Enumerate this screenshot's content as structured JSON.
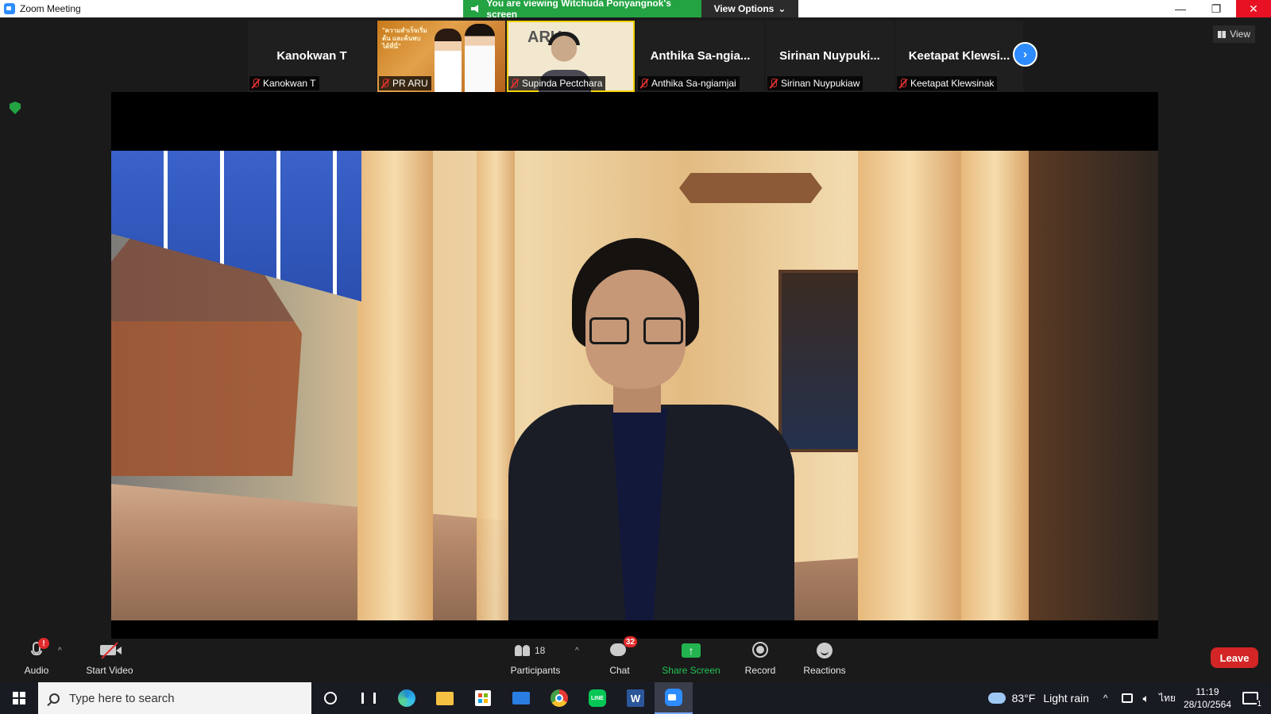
{
  "window": {
    "title": "Zoom Meeting",
    "viewing_banner": "You are viewing Witchuda Ponyangnok's screen",
    "view_options": "View Options",
    "view_label": "View"
  },
  "thumbnails": [
    {
      "big_name": "Kanokwan T",
      "label": "Kanokwan T"
    },
    {
      "big_name": "",
      "label": "PR ARU",
      "poster_text": "\"ความสำเร็จเริ่มต้น และค้นพบได้ที่นี่\""
    },
    {
      "big_name": "",
      "label": "Supinda Pectchara",
      "poster_brand": "ARU"
    },
    {
      "big_name": "Anthika Sa-ngia...",
      "label": "Anthika Sa-ngiamjai"
    },
    {
      "big_name": "Sirinan Nuypuki...",
      "label": "Sirinan Nuypukiaw"
    },
    {
      "big_name": "Keetapat Klewsi...",
      "label": "Keetapat Klewsinak"
    }
  ],
  "toolbar": {
    "audio": "Audio",
    "audio_badge": "!",
    "start_video": "Start Video",
    "participants": "Participants",
    "participants_count": "18",
    "chat": "Chat",
    "chat_badge": "32",
    "share_screen": "Share Screen",
    "record": "Record",
    "reactions": "Reactions",
    "leave": "Leave"
  },
  "taskbar": {
    "search_placeholder": "Type here to search",
    "weather_temp": "83°F",
    "weather_desc": "Light rain",
    "language": "ไทย",
    "time": "11:19",
    "date": "28/10/2564",
    "notification_count": "1"
  },
  "colors": {
    "accent": "#2d8cff",
    "banner_green": "#23a342",
    "leave_red": "#d32525",
    "badge_red": "#e02b2b"
  }
}
